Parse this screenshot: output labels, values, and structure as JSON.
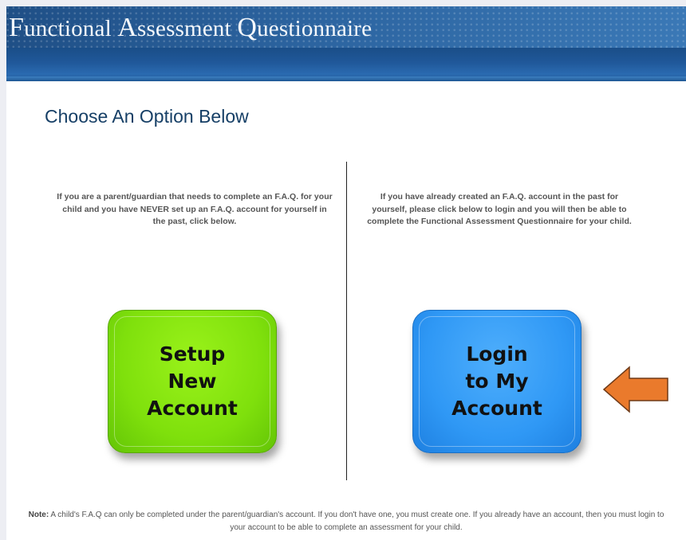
{
  "header": {
    "title_words": [
      {
        "cap": "F",
        "rest": "unctional"
      },
      {
        "cap": "A",
        "rest": "ssessment"
      },
      {
        "cap": "Q",
        "rest": "uestionnaire"
      }
    ]
  },
  "main": {
    "heading": "Choose An Option Below",
    "left": {
      "description": "If you are a parent/guardian that needs to complete an F.A.Q. for your child and you have NEVER set up an F.A.Q. account for yourself in the past, click below.",
      "button_lines": [
        "Setup",
        "New",
        "Account"
      ],
      "button_color": "#7fe00c"
    },
    "right": {
      "description": "If you have already created an F.A.Q. account in the past for yourself, please click below to login and you will then be able to complete the Functional Assessment Questionnaire for your child.",
      "button_lines": [
        "Login",
        "to My",
        "Account"
      ],
      "button_color": "#2f98f5"
    },
    "pointer": {
      "icon": "left-arrow-icon",
      "color": "#ea7a2c"
    }
  },
  "footer": {
    "note_label": "Note:",
    "note_text": " A child's F.A.Q can only be completed under the parent/guardian's account. If you don't have one, you must create one. If you already have an account, then you must login to your account to be able to complete an assessment for your child."
  },
  "colors": {
    "header_blue": "#2c64a0",
    "heading_text": "#163f66"
  }
}
